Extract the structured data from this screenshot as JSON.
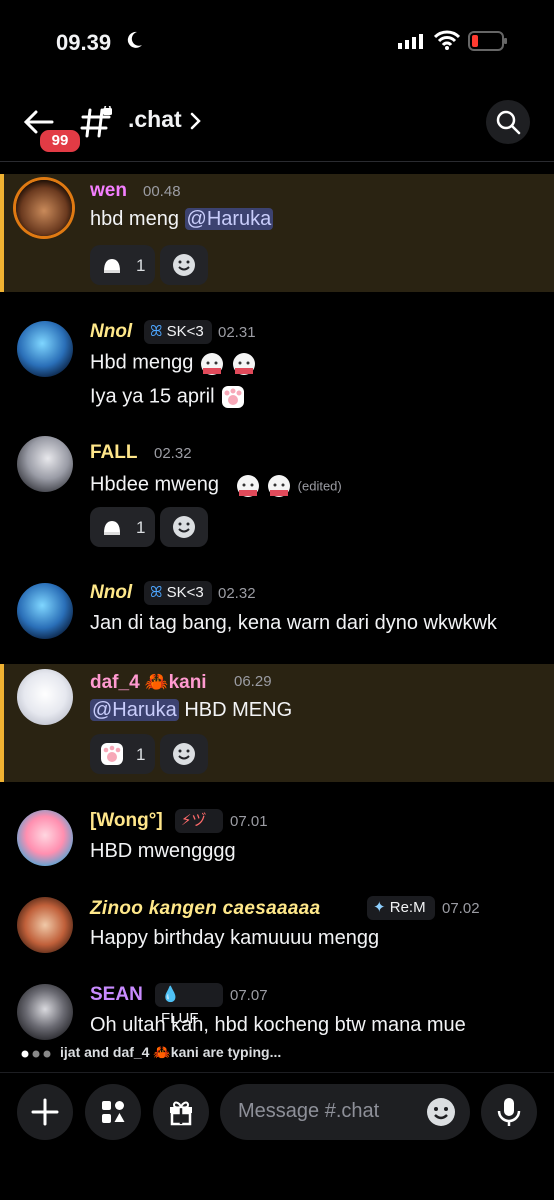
{
  "status_bar": {
    "time": "09.39"
  },
  "header": {
    "badge_count": "99",
    "channel_name": ".chat"
  },
  "messages": [
    {
      "user": "wen",
      "time": "00.48",
      "lines": [
        "hbd meng"
      ],
      "mention": "@Haruka",
      "reaction_count": "1"
    },
    {
      "user": "Nnol",
      "tag": "SK<3",
      "time": "02.31",
      "lines": [
        "Hbd mengg",
        "Iya ya 15 april"
      ]
    },
    {
      "user": "FALL",
      "time": "02.32",
      "lines": [
        "Hbdee mweng"
      ],
      "edited": "(edited)",
      "reaction_count": "1"
    },
    {
      "user": "Nnol",
      "tag": "SK<3",
      "time": "02.32",
      "lines": [
        "Jan di tag bang, kena warn dari dyno wkwkwk"
      ]
    },
    {
      "user": "daf_4 🦀kani",
      "time": "06.29",
      "mention": "@Haruka",
      "lines": [
        "HBD MENG"
      ],
      "reaction_count": "1"
    },
    {
      "user": "[Wong°]",
      "tag": "⚡ヅ",
      "time": "07.01",
      "lines": [
        "HBD mwengggg"
      ]
    },
    {
      "user": "Zinoo kangen caesaaaaa",
      "tag": "Re:M",
      "time": "07.02",
      "lines": [
        "Happy birthday kamuuuu mengg"
      ]
    },
    {
      "user": "SEAN",
      "tag": "FLUF",
      "time": "07.07",
      "lines": [
        "Oh ultah kah, hbd kocheng btw mana mue"
      ]
    }
  ],
  "typing": "ijat and daf_4 🦀kani are typing...",
  "composer": {
    "placeholder": "Message #.chat"
  },
  "colors": {
    "highlight_bg": "#2a2312",
    "highlight_bar": "#f0b232",
    "mention_bg": "#3c4270"
  }
}
